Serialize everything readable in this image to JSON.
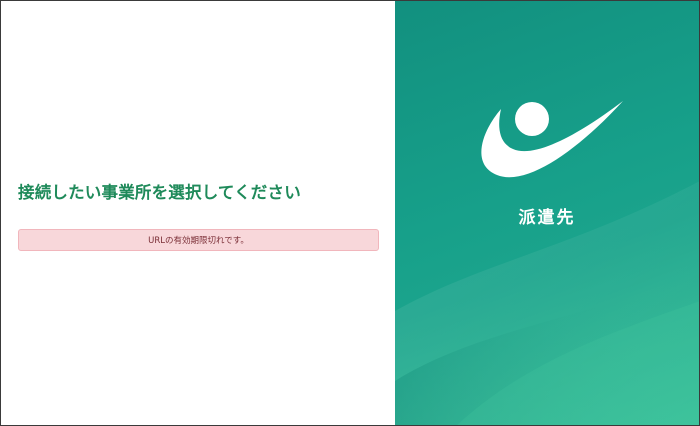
{
  "main": {
    "heading": "接続したい事業所を選択してください",
    "alert_message": "URLの有効期限切れです。"
  },
  "brand": {
    "label": "派遣先",
    "logo_icon": "swoosh-person-logo",
    "panel_color": "#17a08a",
    "accent_color": "#1f8a5a"
  },
  "alert": {
    "background": "#f8d7da",
    "text_color": "#7a2e36"
  }
}
